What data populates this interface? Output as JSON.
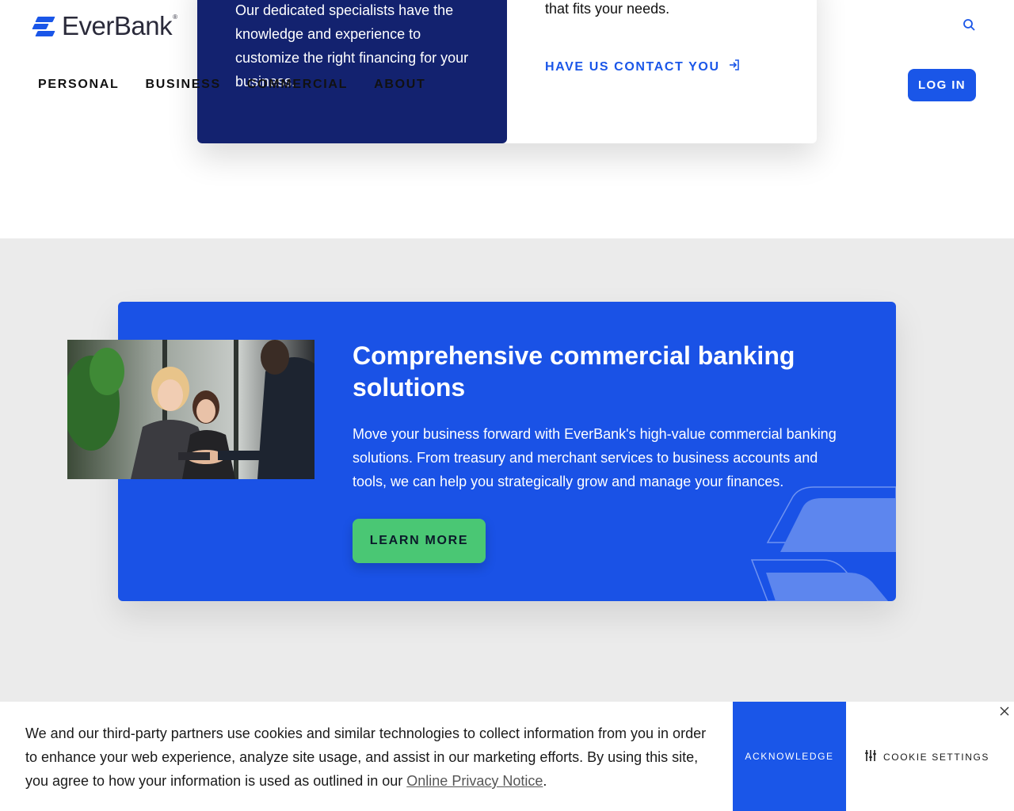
{
  "header": {
    "logo_text": "EverBank",
    "logo_reg": "®",
    "nav": [
      "PERSONAL",
      "BUSINESS",
      "COMMERCIAL",
      "ABOUT"
    ],
    "login_label": "LOG IN",
    "search_icon": "search-icon",
    "accent": "#1a56e8"
  },
  "contact_card": {
    "left_text": "Our dedicated specialists have the knowledge and experience to customize the right financing for your business.",
    "right_text": "together to find a tailored solution that fits your needs.",
    "link_label": "HAVE US CONTACT YOU",
    "link_icon": "arrow-in-icon",
    "left_bg": "#13226f"
  },
  "promo": {
    "title": "Comprehensive commercial banking solutions",
    "body": "Move your business forward with EverBank's high-value commercial banking solutions. From treasury and merchant services to business accounts and tools, we can help you strategically grow and manage your finances.",
    "button_label": "LEARN MORE",
    "bg": "#1a52e6",
    "button_bg": "#4ac774"
  },
  "cookie_banner": {
    "text_before": "We and our third-party partners use cookies and similar technologies to collect information from you in order to enhance your web experience, analyze site usage, and assist in our marketing efforts. By using this site, you agree to how your information is used as outlined in our ",
    "link_text": "Online Privacy Notice",
    "text_after": ".",
    "acknowledge_label": "ACKNOWLEDGE",
    "settings_label": "COOKIE SETTINGS",
    "settings_icon": "sliders-icon",
    "close_icon": "close-icon"
  }
}
